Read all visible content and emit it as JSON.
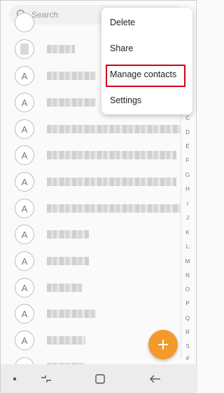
{
  "search": {
    "placeholder": "Search"
  },
  "menu": {
    "items": [
      {
        "label": "Delete"
      },
      {
        "label": "Share"
      },
      {
        "label": "Manage contacts",
        "highlighted": true
      },
      {
        "label": "Settings"
      }
    ]
  },
  "contacts": [
    {
      "avatar_letter": "",
      "name_redacted": true
    },
    {
      "avatar_letter": "",
      "name_redacted": true
    },
    {
      "avatar_letter": "A",
      "name_redacted": true
    },
    {
      "avatar_letter": "A",
      "name_redacted": true
    },
    {
      "avatar_letter": "A",
      "name_redacted": true
    },
    {
      "avatar_letter": "A",
      "name_redacted": true
    },
    {
      "avatar_letter": "A",
      "name_redacted": true
    },
    {
      "avatar_letter": "A",
      "name_redacted": true
    },
    {
      "avatar_letter": "A",
      "name_redacted": true
    },
    {
      "avatar_letter": "A",
      "name_redacted": true
    },
    {
      "avatar_letter": "A",
      "name_redacted": true
    },
    {
      "avatar_letter": "A",
      "name_redacted": true
    },
    {
      "avatar_letter": "A",
      "name_redacted": true
    },
    {
      "avatar_letter": "A",
      "name_redacted": true
    }
  ],
  "index_letters": [
    "C",
    "D",
    "E",
    "F",
    "G",
    "H",
    "I",
    "J",
    "K",
    "L",
    "M",
    "N",
    "O",
    "P",
    "Q",
    "R",
    "S",
    "#"
  ],
  "fab": {
    "icon": "plus-icon",
    "color": "#f39a2b"
  },
  "nav": {
    "icons": [
      "dot-icon",
      "recent-apps-icon",
      "home-icon",
      "back-icon"
    ]
  },
  "colors": {
    "highlight_border": "#d0021b",
    "fab": "#f39a2b"
  }
}
